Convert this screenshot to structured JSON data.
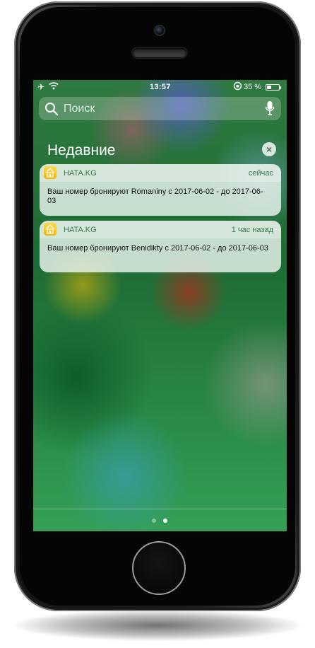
{
  "statusbar": {
    "time": "13:57",
    "battery_text": "35 %",
    "battery_level": 0.35,
    "icons": [
      "airplane-icon",
      "wifi-icon",
      "orientation-lock-icon",
      "battery-icon"
    ]
  },
  "search": {
    "placeholder": "Поиск",
    "icons": [
      "search-icon",
      "microphone-icon"
    ]
  },
  "recent": {
    "title": "Недавние",
    "clear_icon": "close-icon"
  },
  "notifications": [
    {
      "app": "HATA.KG",
      "time": "сейчас",
      "message": "Ваш номер бронируют Romaniny  с 2017-06-02 - до 2017-06-03"
    },
    {
      "app": "HATA.KG",
      "time": "1 час назад",
      "message": "Ваш номер бронируют Benidikty  с 2017-06-02 - до 2017-06-03"
    }
  ],
  "page_indicator": {
    "count": 2,
    "active": 2
  },
  "colors": {
    "accent_green": "#3a7a4c",
    "app_icon": "#f6b300"
  }
}
